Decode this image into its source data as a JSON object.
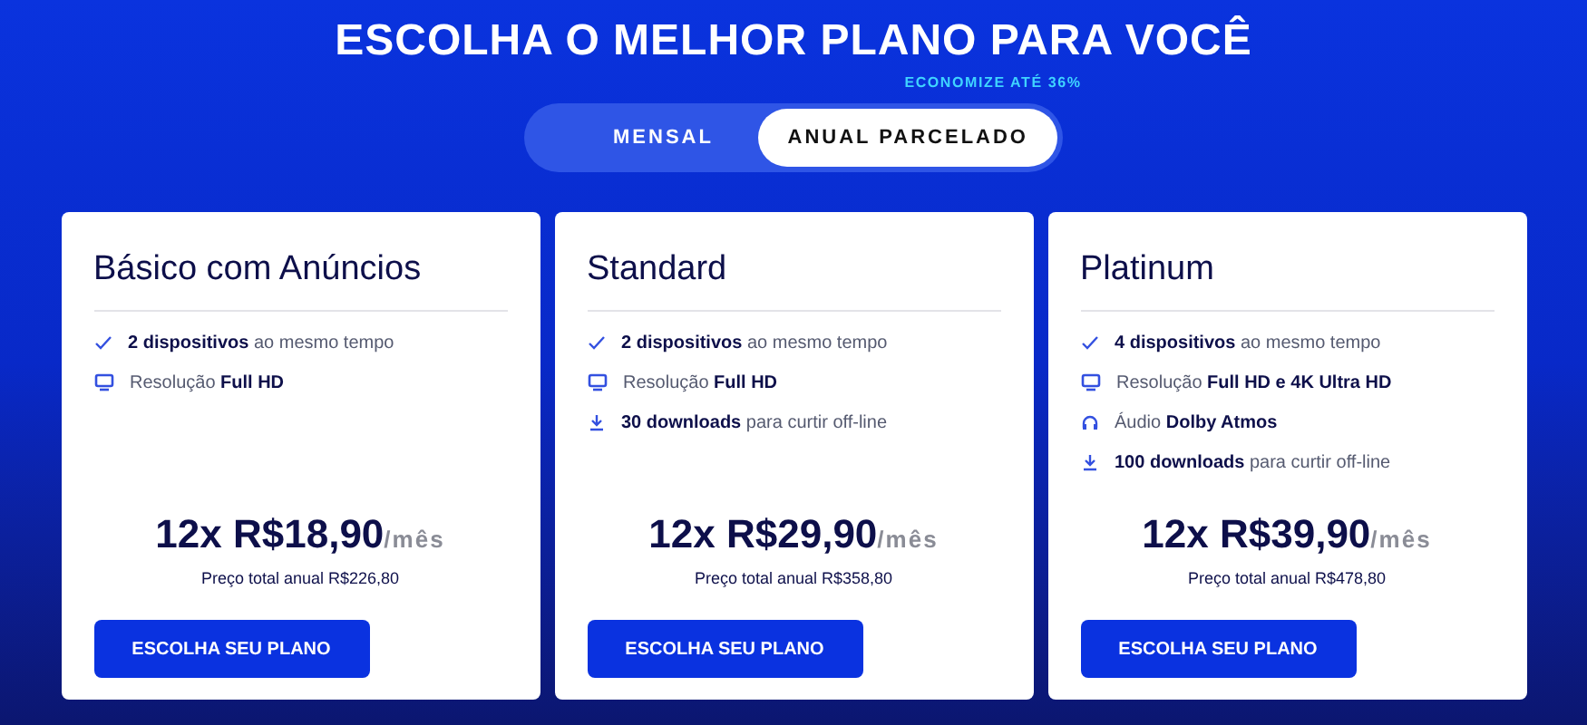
{
  "heading": "ESCOLHA O MELHOR PLANO PARA VOCÊ",
  "discount_note": "ECONOMIZE ATÉ 36%",
  "billing_tabs": [
    {
      "label": "MENSAL",
      "selected": false
    },
    {
      "label": "ANUAL PARCELADO",
      "selected": true
    }
  ],
  "plans": [
    {
      "name": "Básico com Anúncios",
      "features": [
        {
          "kind": "check",
          "text": "**2 dispositivos** ao mesmo tempo"
        },
        {
          "kind": "monitor",
          "text": "Resolução **Full HD**"
        }
      ],
      "price": "12x R$18,90",
      "period": "/mês",
      "total": "Preço total anual R$226,80",
      "button": "ESCOLHA SEU PLANO"
    },
    {
      "name": "Standard",
      "features": [
        {
          "kind": "check",
          "text": "**2 dispositivos** ao mesmo tempo"
        },
        {
          "kind": "monitor",
          "text": "Resolução **Full HD**"
        },
        {
          "kind": "download",
          "text": "**30 downloads** para curtir off-line"
        }
      ],
      "price": "12x R$29,90",
      "period": "/mês",
      "total": "Preço total anual R$358,80",
      "button": "ESCOLHA SEU PLANO"
    },
    {
      "name": "Platinum",
      "features": [
        {
          "kind": "check",
          "text": "**4 dispositivos** ao mesmo tempo"
        },
        {
          "kind": "monitor",
          "text": "Resolução **Full HD e 4K Ultra HD**"
        },
        {
          "kind": "headphones",
          "text": "Áudio **Dolby Atmos**"
        },
        {
          "kind": "download",
          "text": "**100 downloads** para curtir off-line"
        }
      ],
      "price": "12x R$39,90",
      "period": "/mês",
      "total": "Preço total anual R$478,80",
      "button": "ESCOLHA SEU PLANO"
    }
  ]
}
